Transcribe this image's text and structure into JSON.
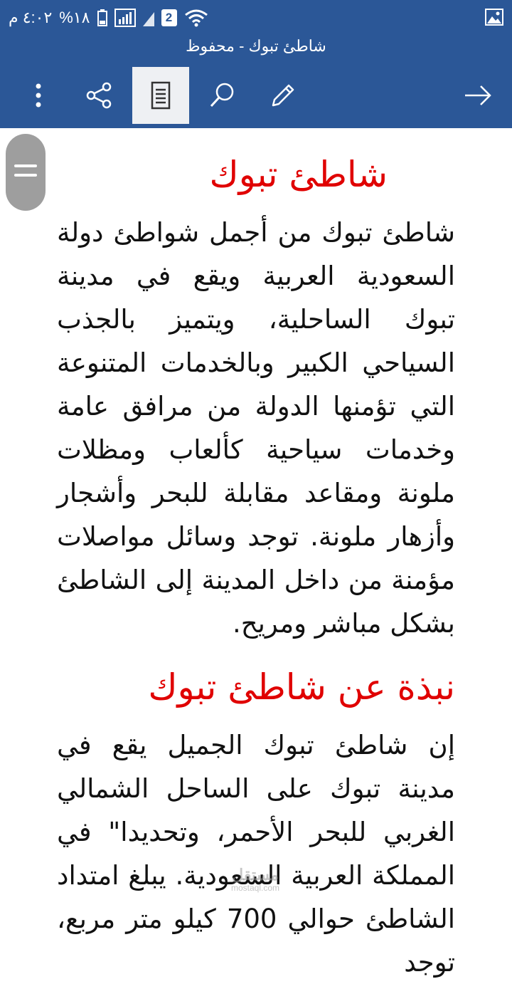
{
  "status_bar": {
    "time": "٤:٠٢ م",
    "battery": "%١٨",
    "sim_badge": "2"
  },
  "app": {
    "document_title": "شاطئ تبوك - محفوظ"
  },
  "toolbar": {
    "icons": [
      "forward-arrow-icon",
      "edit-pencil-icon",
      "search-icon",
      "reading-view-icon",
      "share-icon",
      "more-vert-icon"
    ]
  },
  "document": {
    "heading1": "شاطئ تبوك",
    "paragraph1": "شاطئ تبوك من أجمل شواطئ دولة السعودية العربية ويقع في مدينة تبوك الساحلية، ويتميز بالجذب السياحي الكبير وبالخدمات المتنوعة التي تؤمنها الدولة من مرافق عامة وخدمات سياحية كألعاب ومظلات ملونة ومقاعد مقابلة للبحر وأشجار وأزهار ملونة. توجد وسائل مواصلات مؤمنة من داخل المدينة إلى الشاطئ بشكل مباشر ومريح.",
    "heading2": "نبذة عن شاطئ تبوك",
    "paragraph2": "إن شاطئ تبوك الجميل يقع في مدينة تبوك على الساحل الشمالي الغربي للبحر الأحمر، وتحديدا\" في المملكة العربية السعودية. يبلغ امتداد الشاطئ حوالي 700 كيلو متر مربع، توجد"
  },
  "watermark": {
    "text": "مستقل",
    "sub": "mostaql.com"
  },
  "colors": {
    "header": "#2b5797",
    "heading_red": "#e00000"
  }
}
